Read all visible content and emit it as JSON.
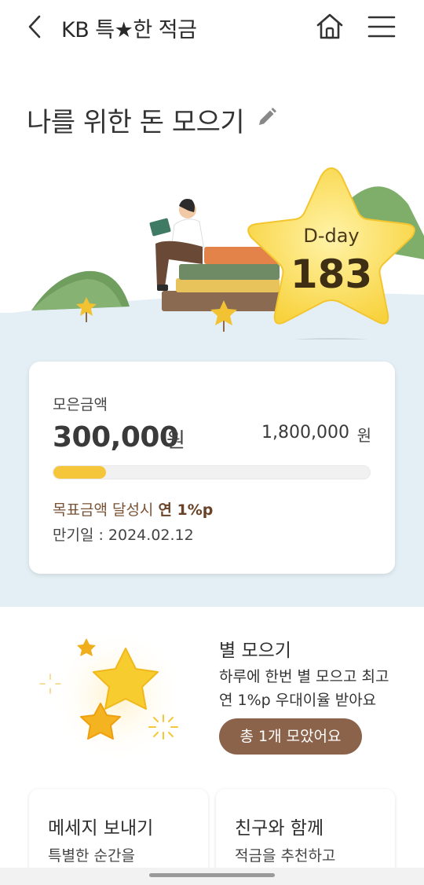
{
  "header": {
    "title": "KB 특★한 적금"
  },
  "page": {
    "title": "나를 위한 돈 모으기"
  },
  "dday": {
    "label": "D-day",
    "value": "183"
  },
  "savings": {
    "saved_label": "모은금액",
    "saved_amount": "300,000",
    "saved_unit": "원",
    "goal_amount": "1,800,000",
    "goal_unit": "원",
    "progress_fraction": 0.167,
    "bonus_text": "목표금액 달성시 ",
    "bonus_rate": "연 1%p",
    "maturity": "만기일 : 2024.02.12"
  },
  "stars": {
    "title": "별 모으기",
    "desc_line1": "하루에 한번 별 모으고 최고",
    "desc_line2": "연 1%p 우대이율 받아요",
    "count_button": "총 1개 모았어요"
  },
  "cards": [
    {
      "title": "메세지 보내기",
      "desc": "특별한 순간을"
    },
    {
      "title": "친구와 함께",
      "desc": "적금을 추천하고"
    }
  ],
  "colors": {
    "accent_brown": "#8b634b",
    "progress_yellow": "#f6c63a",
    "hero_bg": "#e3eff4"
  },
  "icons": {
    "back": "chevron-left-icon",
    "home": "home-icon",
    "menu": "hamburger-menu-icon",
    "edit": "pencil-icon"
  }
}
